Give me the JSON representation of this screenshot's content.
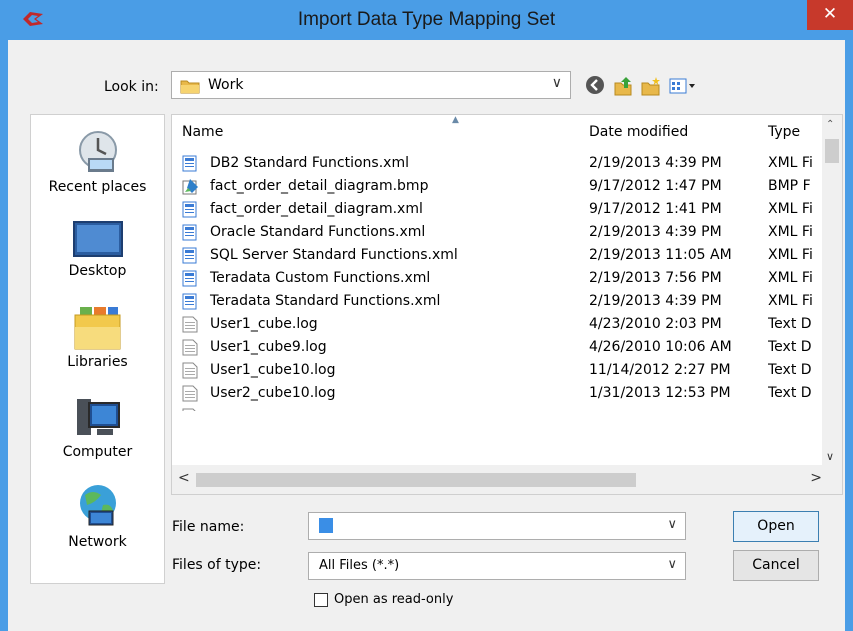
{
  "window": {
    "title": "Import Data Type Mapping Set",
    "close_glyph": "✕",
    "colors": {
      "frame": "#4a9de6",
      "close": "#c7392b"
    }
  },
  "look_in": {
    "label": "Look in:",
    "value": "Work",
    "icon": "folder-icon"
  },
  "toolbar": {
    "buttons": [
      {
        "name": "back-button",
        "icon": "back-arrow-icon"
      },
      {
        "name": "up-folder-button",
        "icon": "up-folder-icon"
      },
      {
        "name": "new-folder-button",
        "icon": "new-folder-icon"
      },
      {
        "name": "view-menu-button",
        "icon": "view-menu-icon"
      }
    ]
  },
  "places": [
    {
      "label": "Recent places",
      "icon": "recent-places-icon"
    },
    {
      "label": "Desktop",
      "icon": "desktop-icon"
    },
    {
      "label": "Libraries",
      "icon": "libraries-icon"
    },
    {
      "label": "Computer",
      "icon": "computer-icon"
    },
    {
      "label": "Network",
      "icon": "network-icon"
    }
  ],
  "file_list": {
    "columns": [
      "Name",
      "Date modified",
      "Type"
    ],
    "rows": [
      {
        "name": "DB2 Standard Functions.xml",
        "date": "2/19/2013 4:39 PM",
        "type": "XML Fi",
        "icon": "xml-file-icon"
      },
      {
        "name": "fact_order_detail_diagram.bmp",
        "date": "9/17/2012 1:47 PM",
        "type": "BMP F",
        "icon": "bmp-file-icon"
      },
      {
        "name": "fact_order_detail_diagram.xml",
        "date": "9/17/2012 1:41 PM",
        "type": "XML Fi",
        "icon": "xml-file-icon"
      },
      {
        "name": "Oracle Standard Functions.xml",
        "date": "2/19/2013 4:39 PM",
        "type": "XML Fi",
        "icon": "xml-file-icon"
      },
      {
        "name": "SQL Server Standard Functions.xml",
        "date": "2/19/2013 11:05 AM",
        "type": "XML Fi",
        "icon": "xml-file-icon"
      },
      {
        "name": "Teradata Custom Functions.xml",
        "date": "2/19/2013 7:56 PM",
        "type": "XML Fi",
        "icon": "xml-file-icon"
      },
      {
        "name": "Teradata Standard Functions.xml",
        "date": "2/19/2013 4:39 PM",
        "type": "XML Fi",
        "icon": "xml-file-icon"
      },
      {
        "name": "User1_cube.log",
        "date": "4/23/2010 2:03 PM",
        "type": "Text D",
        "icon": "text-file-icon"
      },
      {
        "name": "User1_cube9.log",
        "date": "4/26/2010 10:06 AM",
        "type": "Text D",
        "icon": "text-file-icon"
      },
      {
        "name": "User1_cube10.log",
        "date": "11/14/2012 2:27 PM",
        "type": "Text D",
        "icon": "text-file-icon"
      },
      {
        "name": "User2_cube10.log",
        "date": "1/31/2013 12:53 PM",
        "type": "Text D",
        "icon": "text-file-icon"
      }
    ]
  },
  "file_name": {
    "label": "File name:",
    "value": ""
  },
  "file_type": {
    "label": "Files of type:",
    "value": "All Files (*.*)"
  },
  "read_only": {
    "label": "Open as read-only",
    "checked": false
  },
  "buttons": {
    "open": "Open",
    "cancel": "Cancel"
  }
}
